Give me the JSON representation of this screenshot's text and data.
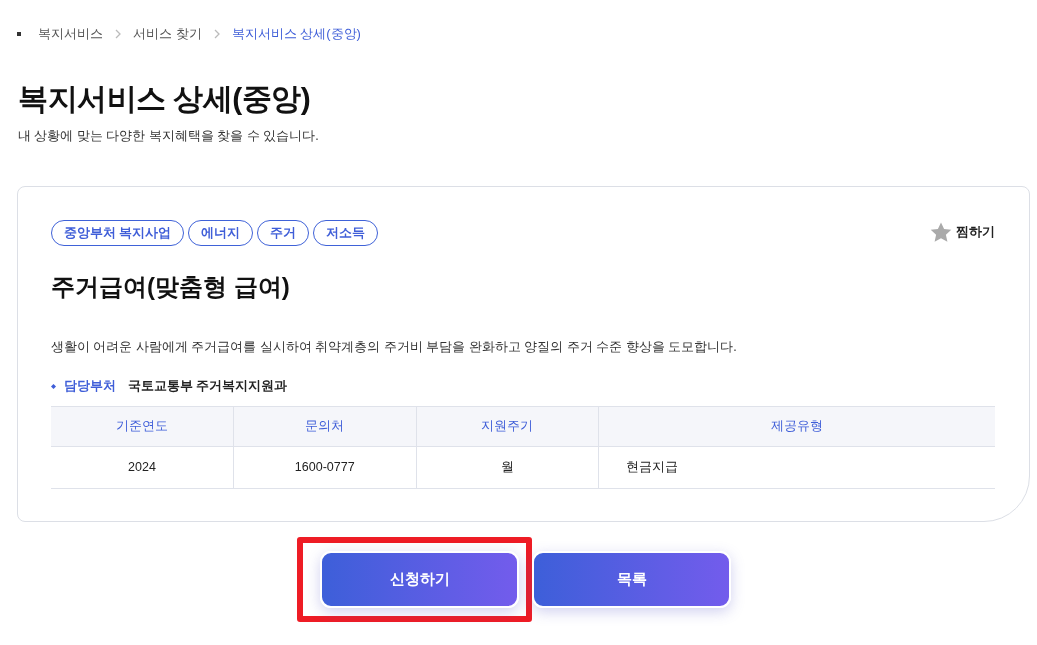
{
  "breadcrumb": [
    {
      "label": "복지서비스",
      "selected": false
    },
    {
      "label": "서비스 찾기",
      "selected": false
    },
    {
      "label": "복지서비스 상세(중앙)",
      "selected": true
    }
  ],
  "page": {
    "title": "복지서비스 상세(중앙)",
    "subtitle": "내 상황에 맞는 다양한 복지혜택을 찾을 수 있습니다."
  },
  "service": {
    "tags": [
      "중앙부처 복지사업",
      "에너지",
      "주거",
      "저소득"
    ],
    "bookmark": {
      "label": "찜하기",
      "on": false
    },
    "title": "주거급여(맞춤형 급여)",
    "description": "생활이 어려운 사람에게 주거급여를 실시하여 취약계층의 주거비 부담을 완화하고 양질의 주거 수준 향상을 도모합니다.",
    "department": {
      "label": "담당부처",
      "value": "국토교통부 주거복지지원과"
    },
    "table": {
      "columns": [
        "기준연도",
        "문의처",
        "지원주기",
        "제공유형"
      ],
      "rows": [
        [
          "2024",
          "1600-0777",
          "월",
          "현금지급"
        ]
      ]
    }
  },
  "buttons": [
    {
      "label": "신청하기",
      "highlighted": true
    },
    {
      "label": "목록",
      "highlighted": false
    }
  ]
}
